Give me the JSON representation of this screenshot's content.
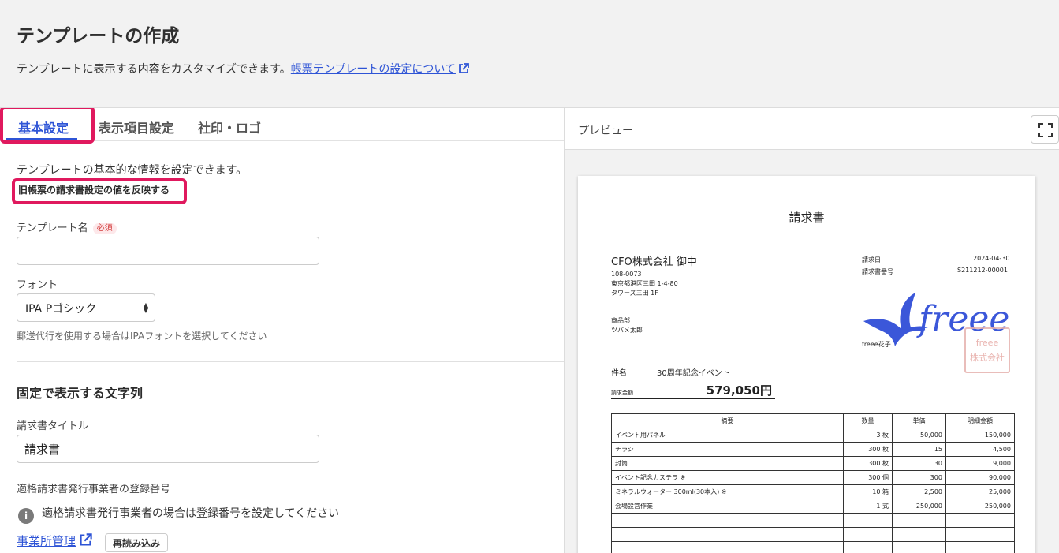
{
  "header": {
    "title": "テンプレートの作成",
    "description": "テンプレートに表示する内容をカスタマイズできます。",
    "help_link": "帳票テンプレートの設定について"
  },
  "tabs": [
    {
      "label": "基本設定",
      "active": true
    },
    {
      "label": "表示項目設定",
      "active": false
    },
    {
      "label": "社印・ロゴ",
      "active": false
    }
  ],
  "basic": {
    "description": "テンプレートの基本的な情報を設定できます。",
    "reflect_button": "旧帳票の請求書設定の値を反映する",
    "template_name_label": "テンプレート名",
    "required_badge": "必須",
    "template_name_value": "",
    "font_label": "フォント",
    "font_value": "IPA Pゴシック",
    "font_hint": "郵送代行を使用する場合はIPAフォントを選択してください"
  },
  "fixed_strings": {
    "section_title": "固定で表示する文字列",
    "invoice_title_label": "請求書タイトル",
    "invoice_title_value": "請求書",
    "registration_label": "適格請求書発行事業者の登録番号",
    "registration_info": "適格請求書発行事業者の場合は登録番号を設定してください",
    "office_link": "事業所管理",
    "reload_button": "再読み込み"
  },
  "preview": {
    "title": "プレビュー",
    "doc_title": "請求書",
    "client_name": "CFO株式会社 御中",
    "postal": "108-0073",
    "address1": "東京都港区三田 1-4-80",
    "address2": "タワーズ三田 1F",
    "dept": "商品部",
    "person": "ツバメ太郎",
    "invoice_date_label": "請求日",
    "invoice_date": "2024-04-30",
    "invoice_no_label": "請求書番号",
    "invoice_no": "S211212-00001",
    "logo_text": "freee",
    "company_name": "freee花子",
    "stamp_text": "freee 株式会社",
    "subject_label": "件名",
    "subject": "30周年記念イベント",
    "amount_label": "請求金額",
    "amount": "579,050円",
    "table_headers": [
      "摘要",
      "数量",
      "単価",
      "明細金額"
    ],
    "table_rows": [
      [
        "イベント用パネル",
        "3 枚",
        "50,000",
        "150,000"
      ],
      [
        "チラシ",
        "300 枚",
        "15",
        "4,500"
      ],
      [
        "封筒",
        "300 枚",
        "30",
        "9,000"
      ],
      [
        "イベント記念カステラ ※",
        "300 個",
        "300",
        "90,000"
      ],
      [
        "ミネラルウォーター 300ml(30本入) ※",
        "10 箱",
        "2,500",
        "25,000"
      ],
      [
        "会場設営作業",
        "1 式",
        "250,000",
        "250,000"
      ],
      [
        "",
        "",
        "",
        ""
      ],
      [
        "",
        "",
        "",
        ""
      ],
      [
        "",
        "",
        "",
        ""
      ]
    ]
  },
  "colors": {
    "accent": "#2e54d6",
    "highlight": "#e0195e",
    "logo": "#3b57d9"
  }
}
